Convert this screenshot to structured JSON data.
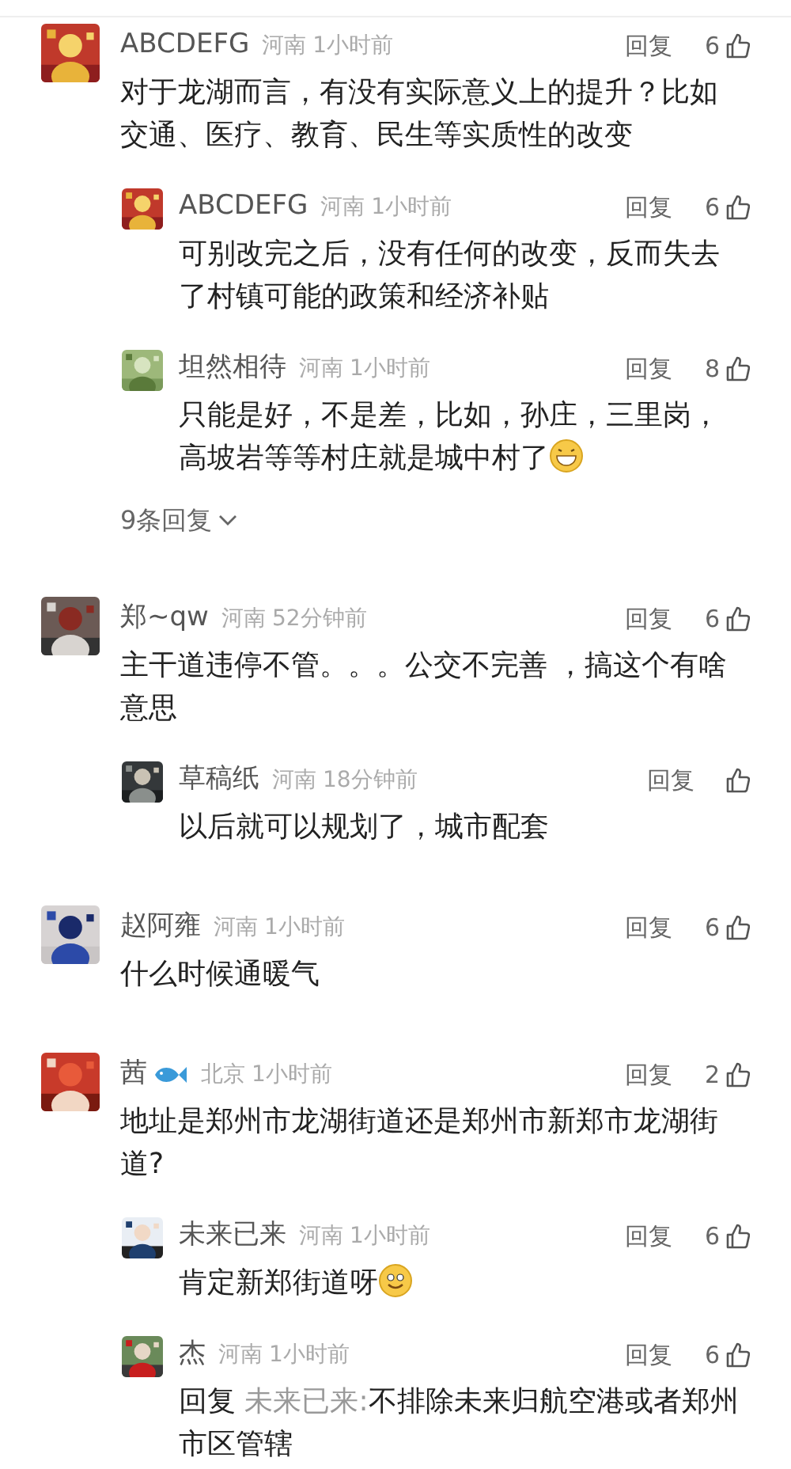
{
  "comments": [
    {
      "name": "ABCDEFG",
      "location": "河南",
      "time": "1小时前",
      "reply_label": "回复",
      "likes": "6",
      "text": "对于龙湖而言，有没有实际意义上的提升？比如交通、医疗、教育、民生等实质性的改变",
      "children": [
        {
          "name": "ABCDEFG",
          "location": "河南",
          "time": "1小时前",
          "reply_label": "回复",
          "likes": "6",
          "text": "可别改完之后，没有任何的改变，反而失去了村镇可能的政策和经济补贴"
        },
        {
          "name": "坦然相待",
          "location": "河南",
          "time": "1小时前",
          "reply_label": "回复",
          "likes": "8",
          "text": "只能是好，不是差，比如，孙庄，三里岗，高坡岩等等村庄就是城中村了",
          "trailing_emoji": {
            "kind": "grin"
          }
        }
      ],
      "more_replies": "9条回复"
    },
    {
      "name": "郑~qw",
      "location": "河南",
      "time": "52分钟前",
      "reply_label": "回复",
      "likes": "6",
      "text": "主干道违停不管。。。公交不完善 ，搞这个有啥意思",
      "children": [
        {
          "name": "草稿纸",
          "location": "河南",
          "time": "18分钟前",
          "reply_label": "回复",
          "text": "以后就可以规划了，城市配套"
        }
      ]
    },
    {
      "name": "赵阿雍",
      "location": "河南",
      "time": "1小时前",
      "reply_label": "回复",
      "likes": "6",
      "text": "什么时候通暖气"
    },
    {
      "name": "茜",
      "name_badge": {
        "kind": "fish"
      },
      "location": "北京",
      "time": "1小时前",
      "reply_label": "回复",
      "likes": "2",
      "text": "地址是郑州市龙湖街道还是郑州市新郑市龙湖街道?",
      "children": [
        {
          "name": "未来已来",
          "location": "河南",
          "time": "1小时前",
          "reply_label": "回复",
          "likes": "6",
          "text": "肯定新郑街道呀",
          "trailing_emoji": {
            "kind": "smile"
          }
        },
        {
          "name": "杰",
          "location": "河南",
          "time": "1小时前",
          "reply_label": "回复",
          "likes": "6",
          "reply_prefix": "回复",
          "reply_to": "未来已来:",
          "text": "不排除未来归航空港或者郑州市区管辖"
        }
      ]
    }
  ]
}
